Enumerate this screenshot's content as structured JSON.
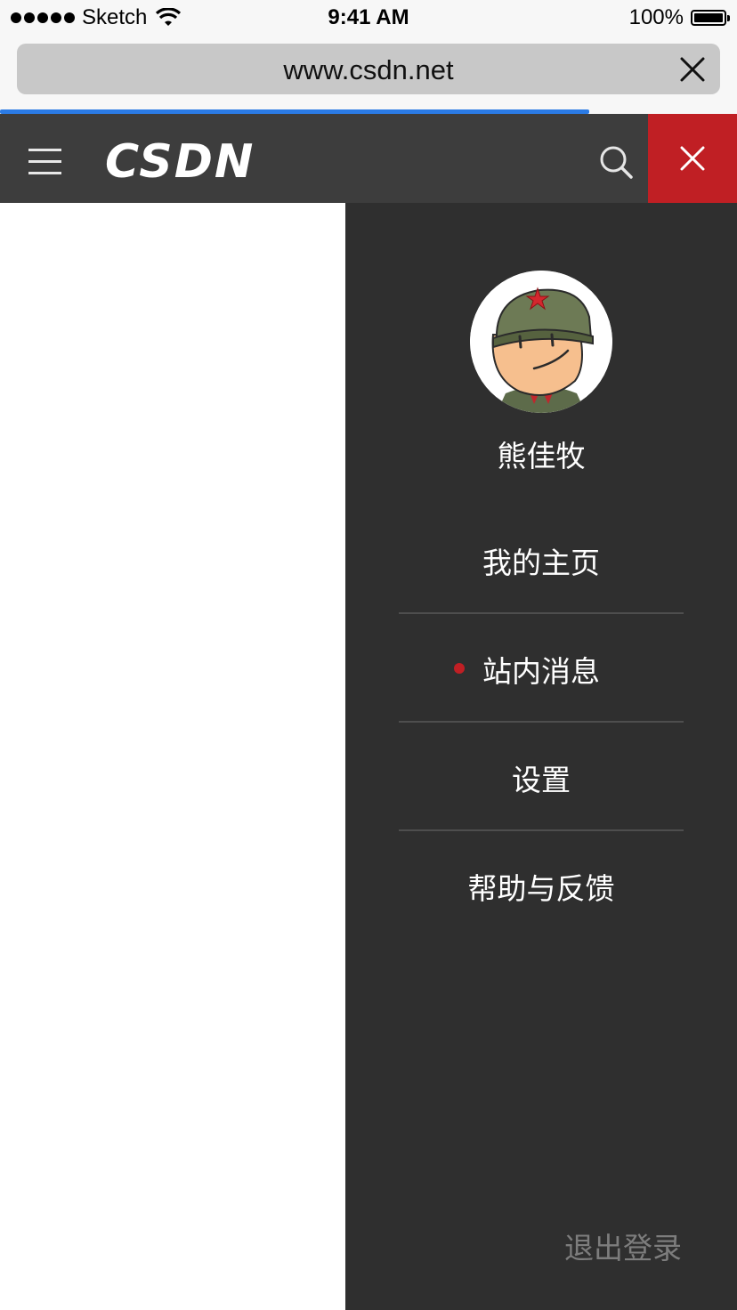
{
  "status_bar": {
    "carrier": "Sketch",
    "time": "9:41 AM",
    "battery": "100%",
    "battery_level": 1.0,
    "icons": [
      "signal-dots-icon",
      "wifi-icon",
      "battery-icon"
    ]
  },
  "browser": {
    "url": "www.csdn.net",
    "load_progress": 0.8,
    "clear_icon": "close-icon"
  },
  "header": {
    "logo": "CSDN",
    "menu_icon": "hamburger-icon",
    "search_icon": "search-icon",
    "close_icon": "close-icon"
  },
  "drawer": {
    "username": "熊佳牧",
    "items": [
      {
        "label": "我的主页",
        "unread": false
      },
      {
        "label": "站内消息",
        "unread": true
      },
      {
        "label": "设置",
        "unread": false
      },
      {
        "label": "帮助与反馈",
        "unread": false
      }
    ],
    "logout": "退出登录"
  },
  "colors": {
    "header_bg": "#3d3d3d",
    "drawer_bg": "#2f2f2f",
    "accent_red": "#c01f24",
    "progress_blue": "#2b7be5"
  }
}
